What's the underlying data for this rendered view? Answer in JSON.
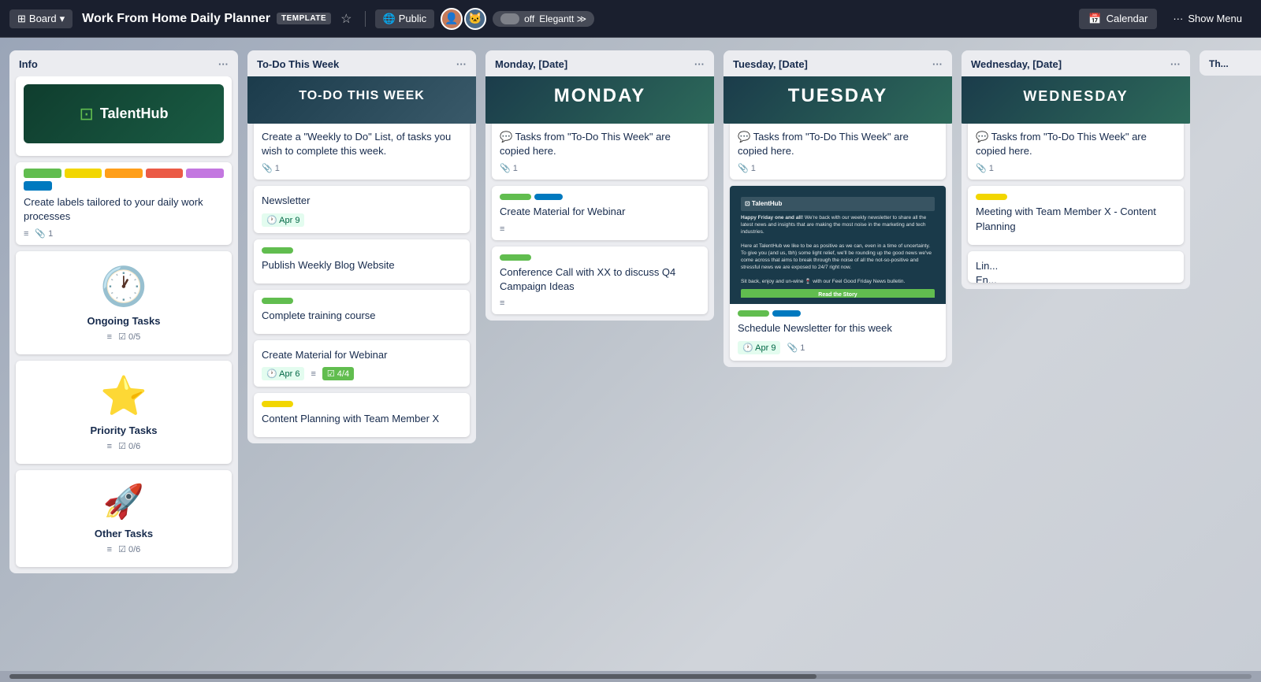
{
  "header": {
    "board_label": "Board",
    "title": "Work From Home Daily Planner",
    "template_badge": "TEMPLATE",
    "visibility": "Public",
    "toggle_off": "off",
    "toggle_brand": "Elegantt ≫",
    "calendar_label": "Calendar",
    "show_menu_label": "Show Menu"
  },
  "columns": [
    {
      "id": "info",
      "title": "Info",
      "cards": [
        {
          "type": "logo",
          "logo_text": "TalentHub"
        },
        {
          "type": "text_labels",
          "text": "Create labels tailored to your daily work processes",
          "labels": [
            "green",
            "yellow",
            "orange",
            "red",
            "purple",
            "blue"
          ],
          "footer": [
            {
              "icon": "≡",
              "value": ""
            },
            {
              "icon": "📎",
              "value": "1"
            }
          ]
        },
        {
          "type": "clock",
          "title": "Ongoing Tasks",
          "meta_desc": true,
          "checklist": "0/5"
        },
        {
          "type": "star",
          "title": "Priority Tasks",
          "meta_desc": true,
          "checklist": "0/6"
        },
        {
          "type": "rocket",
          "title": "Other Tasks",
          "meta_desc": true,
          "checklist": "0/6"
        }
      ]
    },
    {
      "id": "todo",
      "title": "To-Do This Week",
      "cards": [
        {
          "type": "banner",
          "banner_label": "TO-DO THIS WEEK",
          "text": "Create a \"Weekly to Do\" List, of tasks you wish to complete this week.",
          "footer": [
            {
              "icon": "📎",
              "value": "1"
            }
          ]
        },
        {
          "type": "plain",
          "title": "Newsletter",
          "due": "Apr 9"
        },
        {
          "type": "plain_label",
          "label": "green_short",
          "title": "Publish Weekly Blog Website"
        },
        {
          "type": "plain_label",
          "label": "green_short",
          "title": "Complete training course"
        },
        {
          "type": "plain_checklist",
          "title": "Create Material for Webinar",
          "due": "Apr 6",
          "has_desc": true,
          "checklist": "4/4"
        },
        {
          "type": "plain_label_yellow",
          "label": "yellow_short",
          "title": "Content Planning with Team Member X"
        }
      ]
    },
    {
      "id": "monday",
      "title": "Monday, [Date]",
      "cards": [
        {
          "type": "banner",
          "banner_label": "MONDAY",
          "text": "💬 Tasks from \"To-Do This Week\" are copied here.",
          "footer": [
            {
              "icon": "📎",
              "value": "1"
            }
          ]
        },
        {
          "type": "labeled",
          "labels": [
            "green",
            "blue"
          ],
          "title": "Create Material for Webinar",
          "footer": [
            {
              "icon": "≡",
              "value": ""
            }
          ]
        },
        {
          "type": "labeled_green",
          "labels": [
            "green"
          ],
          "title": "Conference Call with XX to discuss Q4 Campaign Ideas",
          "footer": [
            {
              "icon": "≡",
              "value": ""
            }
          ]
        }
      ]
    },
    {
      "id": "tuesday",
      "title": "Tuesday, [Date]",
      "cards": [
        {
          "type": "banner",
          "banner_label": "TUESDAY",
          "text": "💬 Tasks from \"To-Do This Week\" are copied here.",
          "footer": [
            {
              "icon": "📎",
              "value": "1"
            }
          ]
        },
        {
          "type": "email_img",
          "labels": [
            "green",
            "blue"
          ],
          "title": "Schedule Newsletter for this week",
          "due": "Apr 9",
          "attachment": "1"
        }
      ]
    },
    {
      "id": "wednesday",
      "title": "Wednesday, [Date]",
      "cards": [
        {
          "type": "banner",
          "banner_label": "WEDNESDAY",
          "text": "💬 Tasks from \"To-Do This Week\" are copied here.",
          "footer": [
            {
              "icon": "📎",
              "value": "1"
            }
          ]
        },
        {
          "type": "labeled_yellow",
          "labels": [
            "yellow"
          ],
          "title": "Meeting with Team Member X - Content Planning"
        }
      ]
    },
    {
      "id": "thursday_partial",
      "title": "Th...",
      "partial": true
    }
  ]
}
